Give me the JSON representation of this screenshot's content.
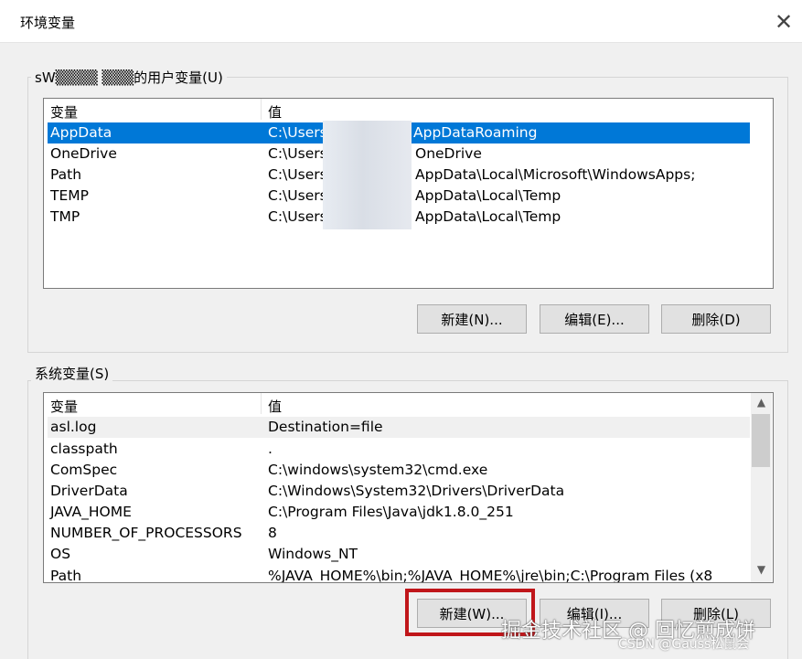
{
  "window": {
    "title": "环境变量",
    "close_glyph": "✕"
  },
  "user_section": {
    "label": "sW▒▒▒▒ ▒▒▒的用户变量(U)",
    "columns": [
      "变量",
      "值"
    ],
    "rows": [
      {
        "name": "AppData",
        "value_prefix": "C:\\Users",
        "value_suffix": "AppDataRoaming",
        "selected": true
      },
      {
        "name": "OneDrive",
        "value_prefix": "C:\\Users",
        "value_suffix": "OneDrive"
      },
      {
        "name": "Path",
        "value_prefix": "C:\\Users",
        "value_suffix": "AppData\\Local\\Microsoft\\WindowsApps;"
      },
      {
        "name": "TEMP",
        "value_prefix": "C:\\Users",
        "value_suffix": "AppData\\Local\\Temp"
      },
      {
        "name": "TMP",
        "value_prefix": "C:\\Users",
        "value_suffix": "AppData\\Local\\Temp"
      }
    ],
    "buttons": {
      "new": "新建(N)...",
      "edit": "编辑(E)...",
      "delete": "删除(D)"
    }
  },
  "system_section": {
    "label": "系统变量(S)",
    "columns": [
      "变量",
      "值"
    ],
    "rows": [
      {
        "name": "asl.log",
        "value": "Destination=file"
      },
      {
        "name": "classpath",
        "value": "."
      },
      {
        "name": "ComSpec",
        "value": "C:\\windows\\system32\\cmd.exe"
      },
      {
        "name": "DriverData",
        "value": "C:\\Windows\\System32\\Drivers\\DriverData"
      },
      {
        "name": "JAVA_HOME",
        "value": "C:\\Program Files\\Java\\jdk1.8.0_251"
      },
      {
        "name": "NUMBER_OF_PROCESSORS",
        "value": "8"
      },
      {
        "name": "OS",
        "value": "Windows_NT"
      },
      {
        "name": "Path",
        "value": "%JAVA_HOME%\\bin;%JAVA_HOME%\\jre\\bin;C:\\Program Files (x8"
      }
    ],
    "buttons": {
      "new": "新建(W)...",
      "edit": "编辑(I)...",
      "delete": "删除(L)"
    },
    "scroll_up": "▲",
    "scroll_down": "▼"
  },
  "watermark": {
    "line1": "掘金技术社区 @ 回忆煎成饼",
    "line2": "CSDN @Gauss松鼠会"
  },
  "colors": {
    "selection": "#0078d7",
    "highlight_box": "#c0161a"
  }
}
